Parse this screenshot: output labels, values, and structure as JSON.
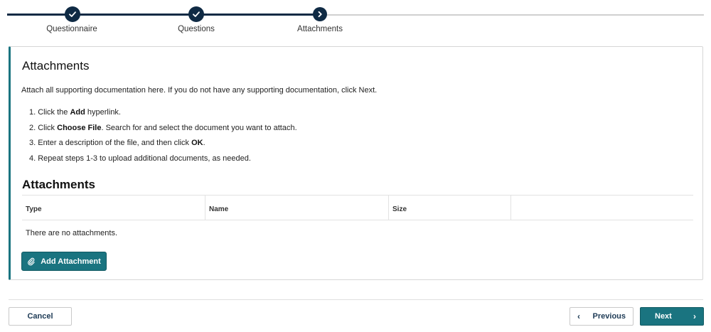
{
  "stepper": {
    "steps": [
      {
        "label": "Questionnaire",
        "status": "complete"
      },
      {
        "label": "Questions",
        "status": "complete"
      },
      {
        "label": "Attachments",
        "status": "current"
      }
    ]
  },
  "main": {
    "title": "Attachments",
    "intro": "Attach all supporting documentation here. If you do not have any supporting documentation, click Next.",
    "instructions": [
      {
        "before": "1. Click the ",
        "bold": "Add",
        "after": " hyperlink."
      },
      {
        "before": "2. Click ",
        "bold": "Choose File",
        "after": ". Search for and select the document you want to attach."
      },
      {
        "before": "3. Enter a description of the file, and then click ",
        "bold": "OK",
        "after": "."
      },
      {
        "before": "4. Repeat steps 1-3 to upload additional documents, as needed.",
        "bold": "",
        "after": ""
      }
    ],
    "attachments_section": {
      "title": "Attachments",
      "columns": [
        "Type",
        "Name",
        "Size",
        ""
      ],
      "empty_message": "There are no attachments.",
      "add_button_label": "Add Attachment"
    }
  },
  "footer": {
    "cancel_label": "Cancel",
    "previous_label": "Previous",
    "next_label": "Next"
  },
  "colors": {
    "accent": "#1a7480",
    "stepper_dark": "#0f2a44"
  },
  "icons": {
    "step_complete": "check-icon",
    "step_current": "chevron-right-icon",
    "add_attachment": "paperclip-icon"
  }
}
